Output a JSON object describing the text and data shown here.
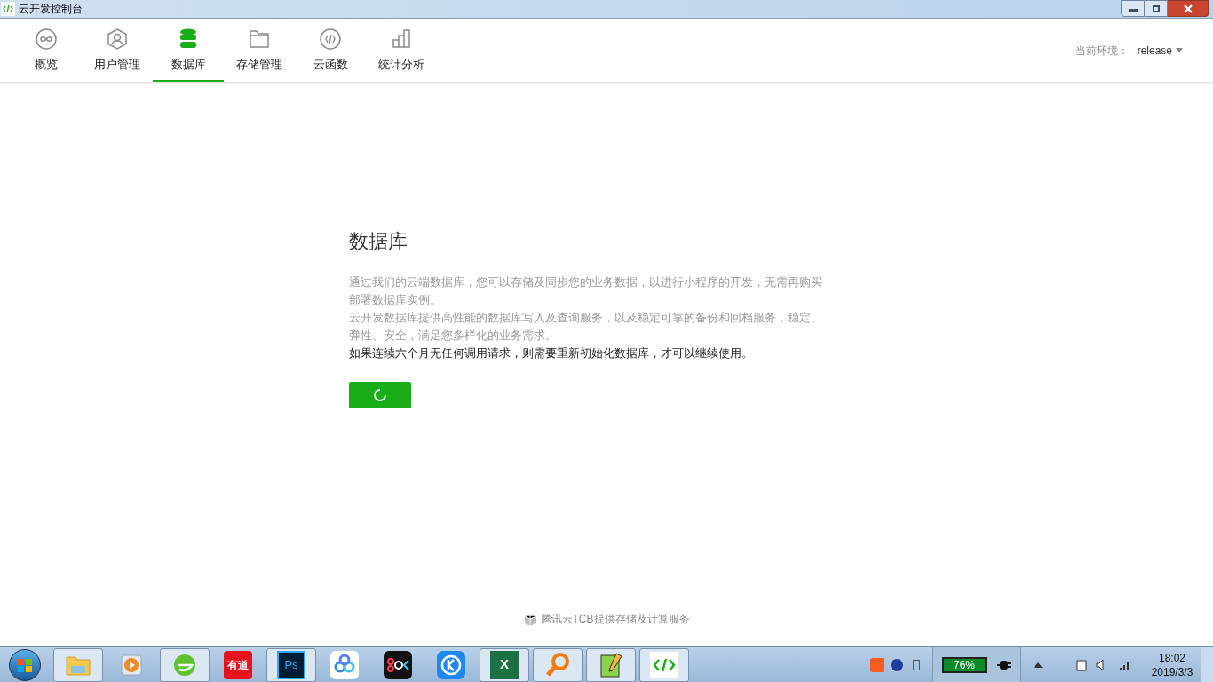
{
  "window": {
    "title": "云开发控制台"
  },
  "nav": [
    {
      "label": "概览",
      "kind": "overview",
      "selected": false
    },
    {
      "label": "用户管理",
      "kind": "users",
      "selected": false
    },
    {
      "label": "数据库",
      "kind": "database",
      "selected": true
    },
    {
      "label": "存储管理",
      "kind": "storage",
      "selected": false
    },
    {
      "label": "云函数",
      "kind": "functions",
      "selected": false
    },
    {
      "label": "统计分析",
      "kind": "stats",
      "selected": false
    }
  ],
  "environment": {
    "label": "当前环境：",
    "value": "release"
  },
  "content": {
    "title": "数据库",
    "paragraphs": [
      "通过我们的云端数据库，您可以存储及同步您的业务数据，以进行小程序的开发，无需再购买部署数据库实例。",
      "云开发数据库提供高性能的数据库写入及查询服务，以及稳定可靠的备份和回档服务，稳定、弹性、安全，满足您多样化的业务需求。"
    ],
    "notice": "如果连续六个月无任何调用请求，则需要重新初始化数据库，才可以继续使用。",
    "button": {
      "loading": true
    }
  },
  "footer": "腾讯云TCB提供存储及计算服务",
  "taskbar": {
    "apps": [
      {
        "kind": "folder",
        "active": true
      },
      {
        "kind": "player",
        "active": false
      },
      {
        "kind": "browser",
        "active": true
      },
      {
        "kind": "youdao",
        "text": "有道",
        "active": false
      },
      {
        "kind": "ps",
        "text": "Ps",
        "active": true
      },
      {
        "kind": "cloud",
        "active": false
      },
      {
        "kind": "dark",
        "active": false
      },
      {
        "kind": "k",
        "active": false
      },
      {
        "kind": "excel",
        "text": "X",
        "active": true
      },
      {
        "kind": "search",
        "active": true
      },
      {
        "kind": "notepad",
        "active": true
      },
      {
        "kind": "code",
        "active": true
      }
    ],
    "battery": "76%",
    "time": "18:02",
    "date": "2019/3/3"
  }
}
